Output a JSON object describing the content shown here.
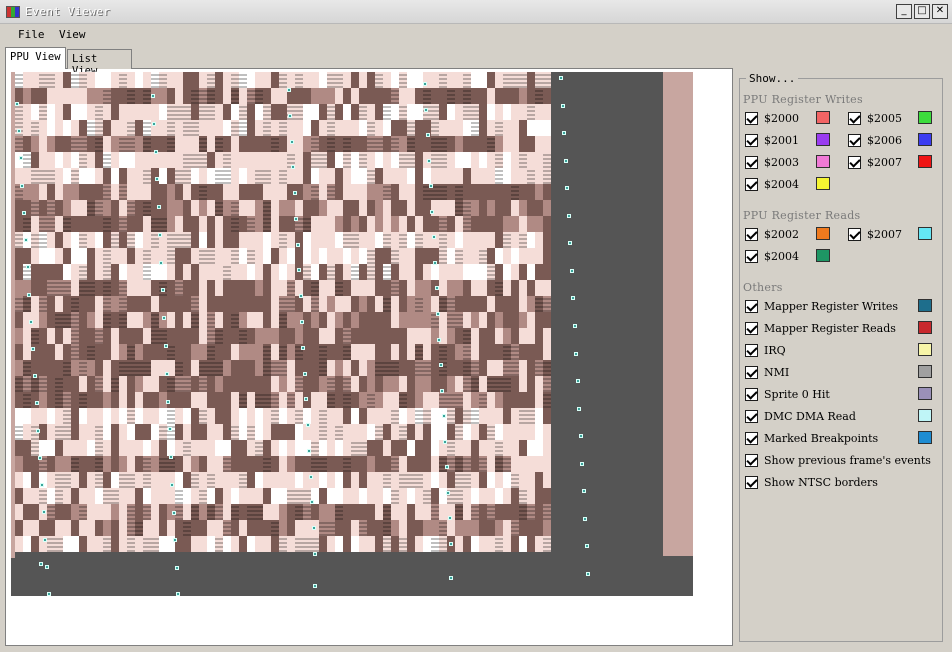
{
  "window": {
    "title": "Event Viewer",
    "buttons": [
      "_",
      "□",
      "✕"
    ]
  },
  "menu": {
    "items": [
      "File",
      "View"
    ]
  },
  "tabs": [
    {
      "label": "PPU View",
      "active": true
    },
    {
      "label": "List View",
      "active": false
    }
  ],
  "show_panel": {
    "title": "Show...",
    "sections": [
      {
        "label": "PPU Register Writes",
        "options": [
          {
            "label": "$2000",
            "checked": true,
            "color": "#f26464"
          },
          {
            "label": "$2005",
            "checked": true,
            "color": "#3cdc3c"
          },
          {
            "label": "$2001",
            "checked": true,
            "color": "#9a3cf0"
          },
          {
            "label": "$2006",
            "checked": true,
            "color": "#3c3cf0"
          },
          {
            "label": "$2003",
            "checked": true,
            "color": "#f07ad6"
          },
          {
            "label": "$2007",
            "checked": true,
            "color": "#f01414"
          },
          {
            "label": "$2004",
            "checked": true,
            "color": "#f5f532"
          }
        ]
      },
      {
        "label": "PPU Register Reads",
        "options": [
          {
            "label": "$2002",
            "checked": true,
            "color": "#f07a1e"
          },
          {
            "label": "$2007",
            "checked": true,
            "color": "#64e6f5"
          },
          {
            "label": "$2004",
            "checked": true,
            "color": "#1e9664"
          }
        ]
      },
      {
        "label": "Others",
        "options": [
          {
            "label": "Mapper Register Writes",
            "checked": true,
            "color": "#1e6e8c"
          },
          {
            "label": "Mapper Register Reads",
            "checked": true,
            "color": "#c8282d"
          },
          {
            "label": "IRQ",
            "checked": true,
            "color": "#f7f5a8"
          },
          {
            "label": "NMI",
            "checked": true,
            "color": "#a0a0a0"
          },
          {
            "label": "Sprite 0 Hit",
            "checked": true,
            "color": "#9a90b8"
          },
          {
            "label": "DMC DMA Read",
            "checked": true,
            "color": "#bff5f7"
          },
          {
            "label": "Marked Breakpoints",
            "checked": true,
            "color": "#1e8cd2"
          },
          {
            "label": "Show previous frame's events",
            "checked": true,
            "color": ""
          },
          {
            "label": "Show NTSC borders",
            "checked": true,
            "color": ""
          }
        ]
      }
    ]
  },
  "ppu_view": {
    "tile_palette": [
      "#7a5a54",
      "#f5ddd8",
      "#c8a6a0",
      "#ffffff",
      "#b08a84"
    ],
    "dot_color": "#3aa39a"
  }
}
